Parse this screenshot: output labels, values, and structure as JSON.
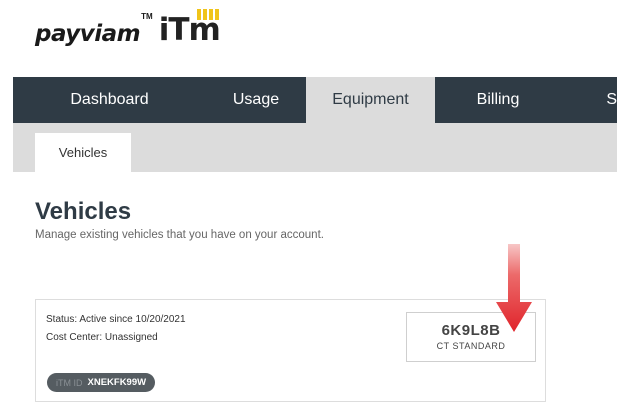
{
  "brand": {
    "name": "payviam",
    "tm": "TM",
    "product": "iTm"
  },
  "nav": {
    "tabs": [
      {
        "label": "Dashboard",
        "active": false
      },
      {
        "label": "Usage",
        "active": false
      },
      {
        "label": "Equipment",
        "active": true
      },
      {
        "label": "Billing",
        "active": false
      },
      {
        "label": "S",
        "active": false
      }
    ]
  },
  "subnav": {
    "tabs": [
      {
        "label": "Vehicles",
        "active": true
      }
    ]
  },
  "page": {
    "title": "Vehicles",
    "subtitle": "Manage existing vehicles that you have on your account."
  },
  "vehicle": {
    "status_label": "Status:",
    "status_value": "Active since 10/20/2021",
    "cost_center_label": "Cost Center:",
    "cost_center_value": "Unassigned",
    "plate": "6K9L8B",
    "plate_type": "CT STANDARD",
    "itm_label": "iTM ID",
    "itm_id": "XNEKFK99W"
  },
  "colors": {
    "nav_bg": "#2f3b45",
    "active_tab_bg": "#dcdcdc",
    "logo_accent": "#f0c419",
    "arrow": "#e0242b"
  }
}
